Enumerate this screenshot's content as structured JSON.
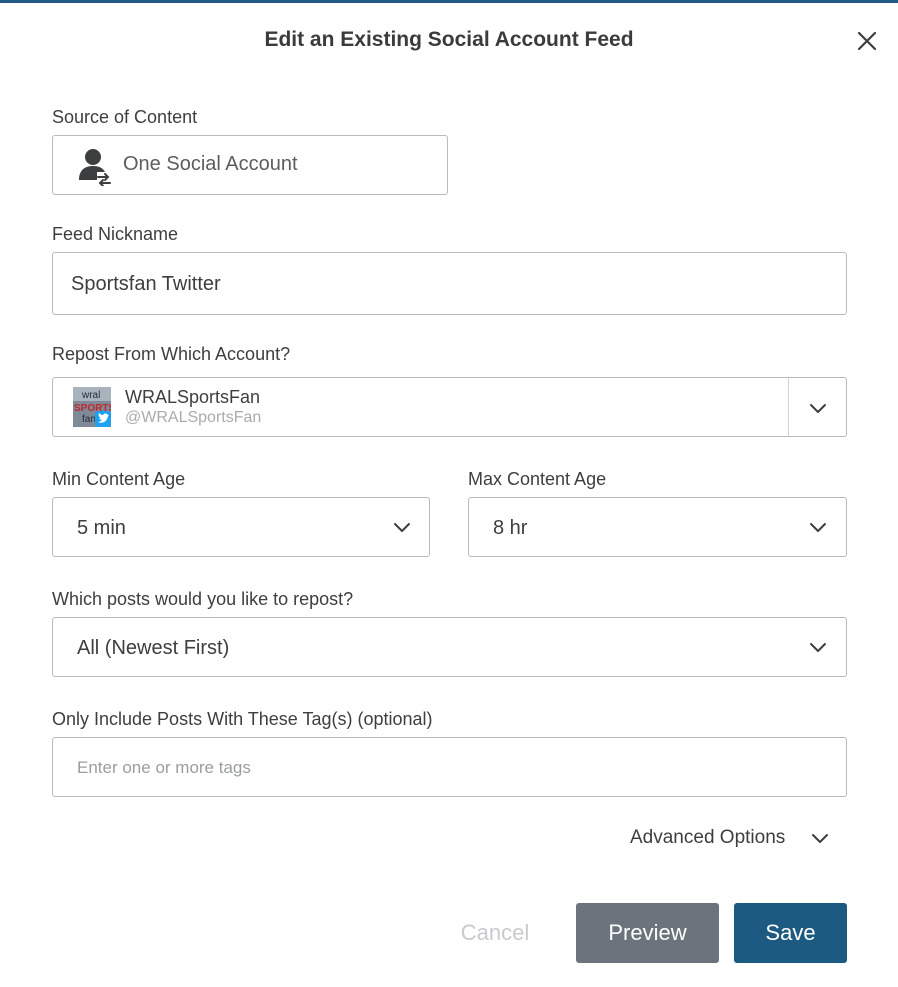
{
  "dialog": {
    "title": "Edit an Existing Social Account Feed"
  },
  "source": {
    "label": "Source of Content",
    "value": "One Social Account",
    "icon": "user-repost-icon"
  },
  "nickname": {
    "label": "Feed Nickname",
    "value": "Sportsfan Twitter"
  },
  "repost_account": {
    "label": "Repost From Which Account?",
    "name": "WRALSportsFan",
    "handle": "@WRALSportsFan",
    "avatar_text_1": "wral",
    "avatar_text_2": "SPORTS",
    "avatar_text_3": "fan",
    "network_icon": "twitter-icon"
  },
  "min_age": {
    "label": "Min Content Age",
    "value": "5 min"
  },
  "max_age": {
    "label": "Max Content Age",
    "value": "8 hr"
  },
  "posts": {
    "label": "Which posts would you like to repost?",
    "value": "All (Newest First)"
  },
  "tags": {
    "label": "Only Include Posts With These Tag(s) (optional)",
    "placeholder": "Enter one or more tags"
  },
  "advanced": {
    "label": "Advanced Options"
  },
  "buttons": {
    "cancel": "Cancel",
    "preview": "Preview",
    "save": "Save"
  },
  "colors": {
    "accent": "#1d5a82",
    "preview_button": "#6b747d",
    "border": "#b8bbbe",
    "twitter": "#1da1f2"
  }
}
